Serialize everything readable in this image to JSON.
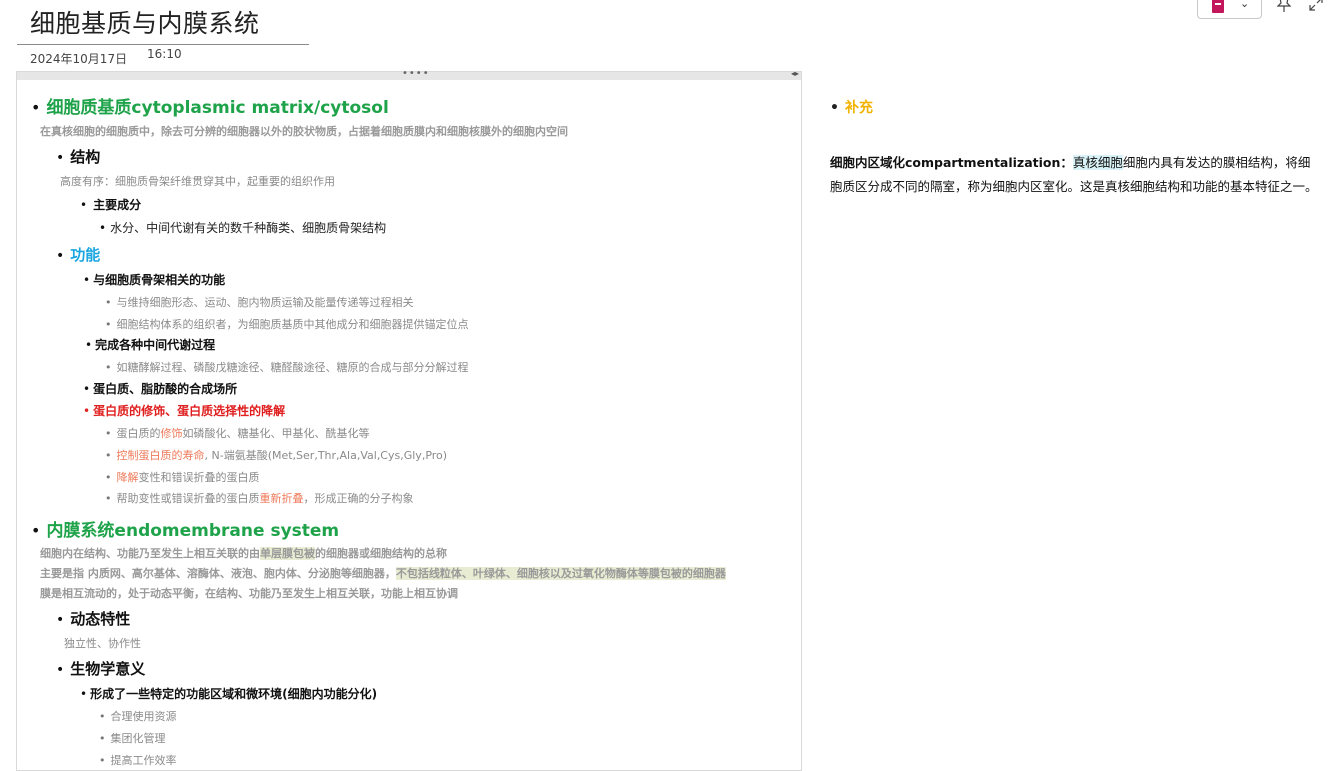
{
  "page": {
    "title": "细胞基质与内膜系统",
    "date": "2024年10月17日",
    "time": "16:10"
  },
  "toolbar": {
    "notebook_icon": "notebook-icon",
    "chevron": "⌄",
    "pin_icon": "pin-icon",
    "expand_icon": "expand-icon"
  },
  "outline": {
    "h1_matrix": "细胞质基质cytoplasmic matrix/cytosol",
    "matrix_desc": "在真核细胞的细胞质中，除去可分辨的细胞器以外的胶状物质，占据着细胞质膜内和细胞核膜外的细胞内空间",
    "structure": "结构",
    "structure_desc": "高度有序：细胞质骨架纤维贯穿其中，起重要的组织作用",
    "main_components": "主要成分",
    "components_text": "水分、中间代谢有关的数千种酶类、细胞质骨架结构",
    "function": "功能",
    "func_cyto": "与细胞质骨架相关的功能",
    "func_cyto_1": "与维持细胞形态、运动、胞内物质运输及能量传递等过程相关",
    "func_cyto_2": "细胞结构体系的组织者，为细胞质基质中其他成分和细胞器提供锚定位点",
    "func_metab": "完成各种中间代谢过程",
    "func_metab_1": "如糖酵解过程、磷酸戊糖途径、糖醛酸途径、糖原的合成与部分分解过程",
    "func_synth": "蛋白质、脂肪酸的合成场所",
    "func_modify": "蛋白质的修饰、蛋白质选择性的降解",
    "mod_1a": "蛋白质的",
    "mod_1b": "修饰",
    "mod_1c": "如磷酸化、糖基化、甲基化、酰基化等",
    "mod_2a": "控制蛋白质的寿命",
    "mod_2b": ", N-端氨基酸(Met,Ser,Thr,Ala,Val,Cys,Gly,Pro)",
    "mod_3a": "降解",
    "mod_3b": "变性和错误折叠的蛋白质",
    "mod_4a": "帮助变性或错误折叠的蛋白质",
    "mod_4b": "重新折叠",
    "mod_4c": "，形成正确的分子构象",
    "h1_endo": "内膜系统endomembrane system",
    "endo_1a": "细胞内在结构、功能乃至发生上相互关联的由",
    "endo_1b": "单层膜包被",
    "endo_1c": "的细胞器或细胞结构的总称",
    "endo_2a": "主要是指 内质网、高尔基体、溶酶体、液泡、胞内体、分泌胞等细胞器，",
    "endo_2b": "不包括线粒体、叶绿体、细胞核以及过氧化物酶体等膜包被的细胞器",
    "endo_3": "膜是相互流动的，处于动态平衡，在结构、功能乃至发生上相互关联，功能上相互协调",
    "dynamic": "动态特性",
    "dynamic_desc": "独立性、协作性",
    "bio_meaning": "生物学意义",
    "microenv": "形成了一些特定的功能区域和微环境(细胞内功能分化)",
    "micro_1": "合理使用资源",
    "micro_2": "集团化管理",
    "micro_3": "提高工作效率"
  },
  "side": {
    "heading": "补充",
    "term": "细胞内区域化compartmentalization：",
    "highlight": "真核细胞",
    "text": "细胞内具有发达的膜相结构，将细胞质区分成不同的隔室，称为细胞内区室化。这是真核细胞结构和功能的基本特征之一。"
  },
  "colors": {
    "green_heading": "#1fa34a",
    "blue_heading": "#1aa6e0",
    "red_heading": "#e02020",
    "orange_text": "#ee7a5a",
    "side_heading": "#f1b200"
  }
}
